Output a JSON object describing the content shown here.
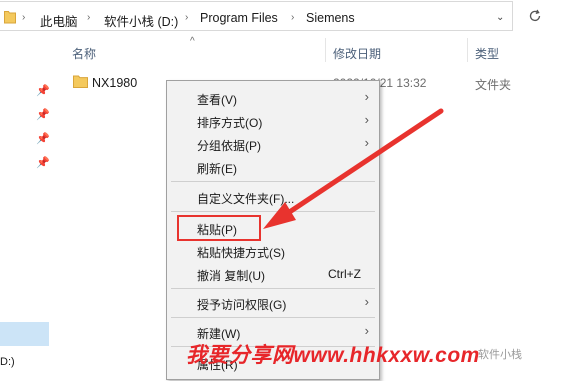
{
  "breadcrumb": [
    "此电脑",
    "软件小栈 (D:)",
    "Program Files",
    "Siemens"
  ],
  "columns": {
    "name": "名称",
    "date": "修改日期",
    "type": "类型"
  },
  "file": {
    "name": "NX1980",
    "date": "2022/10/21 13:32",
    "type": "文件夹"
  },
  "nav": {
    "drive_label": "D:)"
  },
  "menu": [
    {
      "label": "查看(V)",
      "submenu": true
    },
    {
      "label": "排序方式(O)",
      "submenu": true
    },
    {
      "label": "分组依据(P)",
      "submenu": true
    },
    {
      "label": "刷新(E)"
    },
    {
      "label": "自定义文件夹(F)..."
    },
    {
      "label": "粘贴(P)"
    },
    {
      "label": "粘贴快捷方式(S)"
    },
    {
      "label": "撤消 复制(U)",
      "shortcut": "Ctrl+Z"
    },
    {
      "label": "授予访问权限(G)",
      "submenu": true
    },
    {
      "label": "新建(W)",
      "submenu": true
    },
    {
      "label": "属性(R)"
    }
  ],
  "watermark": {
    "text": "我要分享网www.hhkxxw.com",
    "sub": "软件小栈"
  },
  "colors": {
    "highlight_box": "#e8332e",
    "arrow": "#e8332e",
    "watermark": "#e7262a",
    "folder": "#f4c95d"
  }
}
